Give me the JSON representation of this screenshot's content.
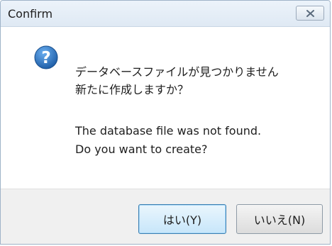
{
  "window": {
    "title": "Confirm",
    "close_icon": "close-icon"
  },
  "message": {
    "icon": "question-icon",
    "line_ja_1": "データベースファイルが見つかりません",
    "line_ja_2": "新たに作成しますか？",
    "line_en_1": "The database file was not found.",
    "line_en_2": "Do you want to create?"
  },
  "buttons": {
    "yes_label": "はい(Y)",
    "no_label": "いいえ(N)"
  },
  "colors": {
    "icon_blue": "#1f5fa8",
    "default_button_border": "#3c7fb1"
  }
}
